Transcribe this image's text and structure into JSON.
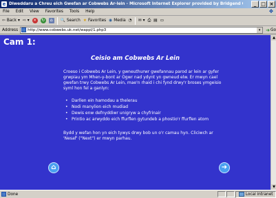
{
  "window": {
    "title": "Diweddaru a Chreu eich Gwefan ar Cobwebs Ar-lein - Microsoft Internet Explorer provided by Bridgend County Borough Council"
  },
  "menu": [
    "File",
    "Edit",
    "View",
    "Favorites",
    "Tools",
    "Help"
  ],
  "toolbar": {
    "back": "Back",
    "search": "Search",
    "favorites": "Favorites",
    "media": "Media"
  },
  "address": {
    "label": "Address",
    "url": "http://www.cobwebs.uk.net/wappl/1.php3",
    "go": "Go"
  },
  "page": {
    "step": "Cam 1:",
    "heading": "Ceisio am Cobwebs Ar Lein",
    "intro": "Croeso i Cobwebs Ar Lein, y gwneuthurwr gwefannau parod ar lein ar gyfer grwpiau ym Mhen-y-bont ar Ogwr nad ydynt yn gwneud elw. Er mwyn cael gwefan trwy Cobwebs Ar Lein, mae'n rhaid i chi fynd drwy'r broses ymgeisio syml hon fel a ganlyn:",
    "steps": [
      "Darllen ein hamodau a thelerau",
      "Nodi manylion eich mudiad",
      "Dewis enw defnyddiwr unigryw a chyfrinair",
      "Printio ac arwyddo eich ffurflen gytundeb a phostio'r ffurflen atom"
    ],
    "outro": "Bydd y wefan hon yn eich tywys drwy bob un o'r camau hyn. Cliciwch ar 'Nesaf' (\"Next\") er mwyn parhau."
  },
  "status": {
    "left": "Done",
    "zone": "Local intranet"
  },
  "icons": {
    "home": "home-icon",
    "next": "next-arrow-icon"
  },
  "colors": {
    "page_background": "#3333cc",
    "nav_button": "#4aa0f0"
  }
}
